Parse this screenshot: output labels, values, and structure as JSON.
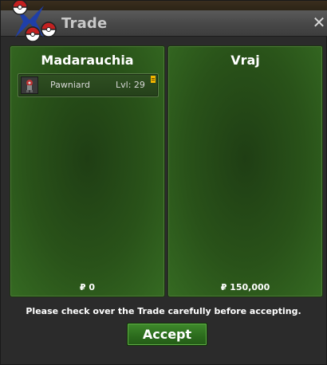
{
  "window": {
    "title": "Trade",
    "close_label": "✕"
  },
  "left_panel": {
    "player_name": "Madarauchia",
    "pokemon": [
      {
        "name": "Pawniard",
        "level": "Lvl: 29",
        "icon": "pawniard-sprite-icon",
        "held_item": true
      }
    ],
    "money": "₽ 0"
  },
  "right_panel": {
    "player_name": "Vraj",
    "pokemon": [],
    "money": "₽ 150,000"
  },
  "notice": "Please check over the Trade carefully before accepting.",
  "accept_label": "Accept",
  "colors": {
    "panel_green": "#295219",
    "accept_green": "#2b6a1c",
    "titlebar_gray": "#474747",
    "logo_blue": "#1f3fa8",
    "logo_red": "#c42020"
  }
}
